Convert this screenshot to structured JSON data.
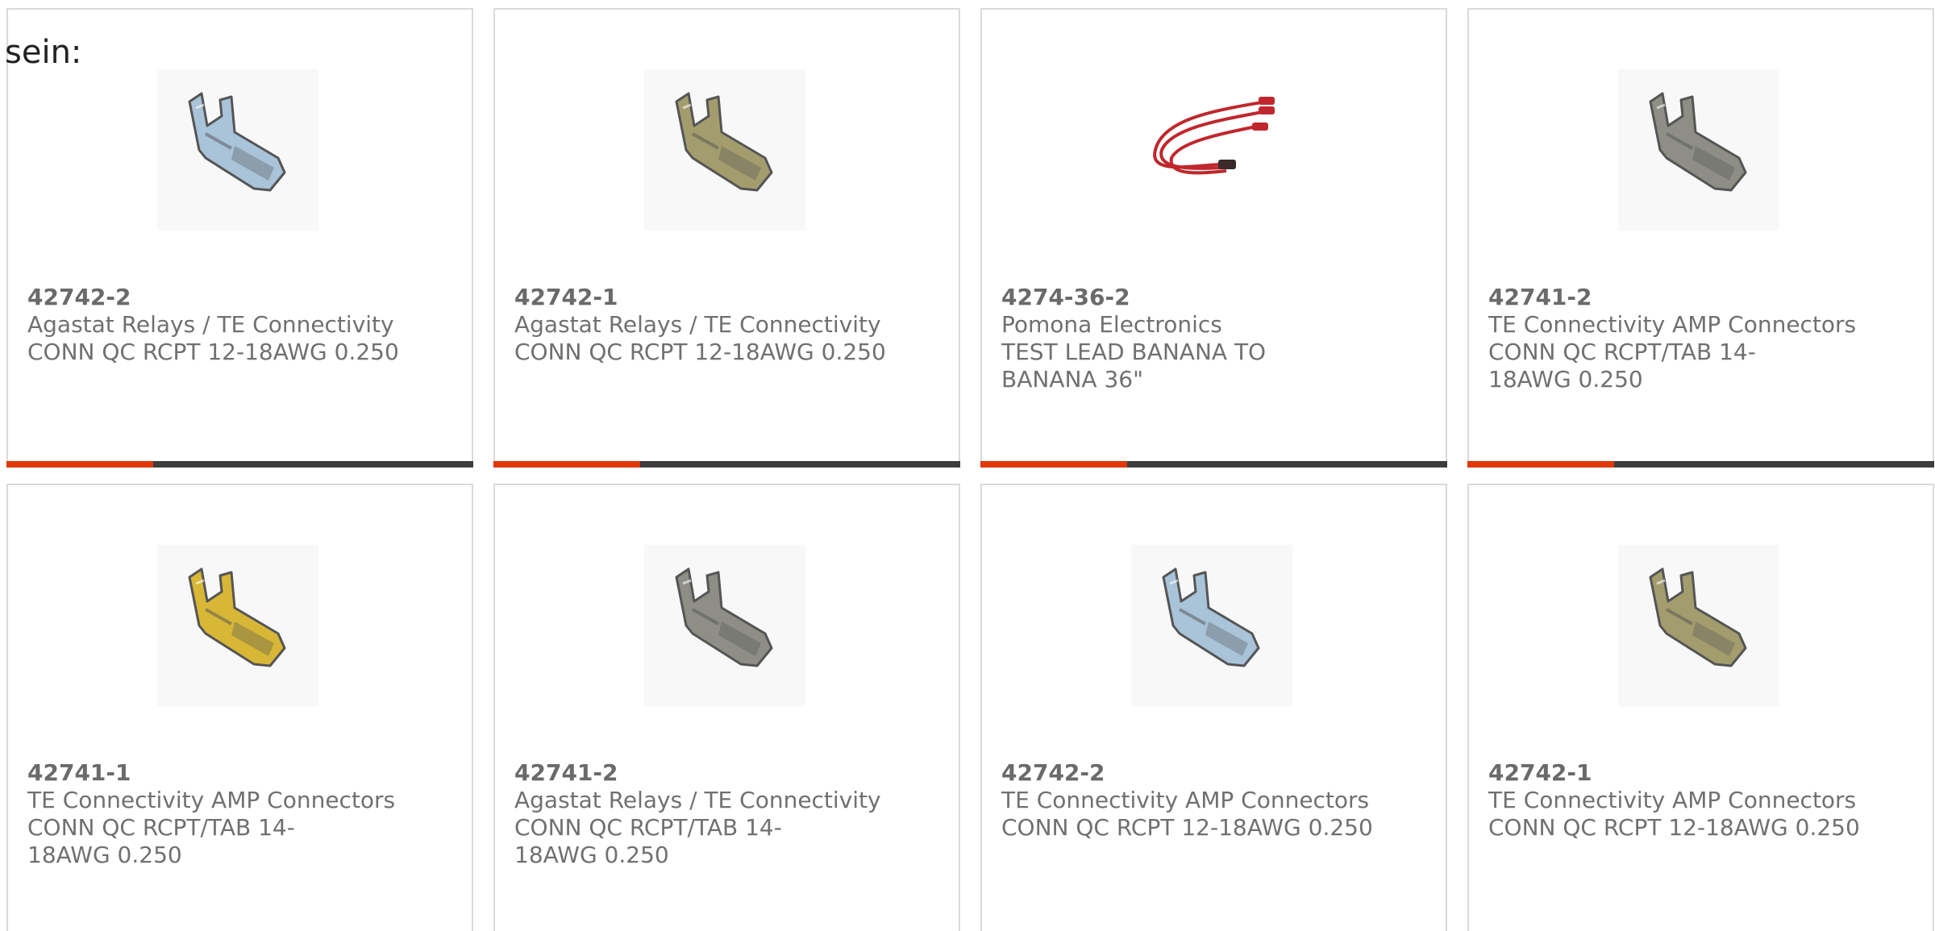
{
  "intro_text": "sein:",
  "colors": {
    "accent": "#e2360b",
    "bar_dark": "#3d3d3d",
    "text": "#707070",
    "border": "#dadada"
  },
  "products": [
    {
      "part_number": "42742-2",
      "manufacturer": "Agastat Relays / TE Connectivity",
      "description": "CONN QC RCPT 12-18AWG 0.250",
      "image": "connector-silver-icon",
      "tint": "#a9c3d9",
      "bar_accent_fraction": 0.315
    },
    {
      "part_number": "42742-1",
      "manufacturer": "Agastat Relays / TE Connectivity",
      "description": "CONN QC RCPT 12-18AWG 0.250",
      "image": "connector-brass-icon",
      "tint": "#a39d6e",
      "bar_accent_fraction": 0.315
    },
    {
      "part_number": "4274-36-2",
      "manufacturer": "Pomona Electronics",
      "description": "TEST LEAD BANANA TO BANANA 36\"",
      "image": "test-lead-icon",
      "tint": "#c0272d",
      "bar_accent_fraction": 0.315
    },
    {
      "part_number": "42741-2",
      "manufacturer": "TE Connectivity AMP Connectors",
      "description": "CONN QC RCPT/TAB 14-18AWG 0.250",
      "image": "connector-steel-icon",
      "tint": "#8e8e86",
      "bar_accent_fraction": 0.315
    },
    {
      "part_number": "42741-1",
      "manufacturer": "TE Connectivity AMP Connectors",
      "description": "CONN QC RCPT/TAB 14-18AWG 0.250",
      "image": "connector-gold-icon",
      "tint": "#d8b737",
      "bar_accent_fraction": 0
    },
    {
      "part_number": "42741-2",
      "manufacturer": "Agastat Relays / TE Connectivity",
      "description": "CONN QC RCPT/TAB 14-18AWG 0.250",
      "image": "connector-steel-icon",
      "tint": "#8e8e86",
      "bar_accent_fraction": 0
    },
    {
      "part_number": "42742-2",
      "manufacturer": "TE Connectivity AMP Connectors",
      "description": "CONN QC RCPT 12-18AWG 0.250",
      "image": "connector-silver-icon",
      "tint": "#a9c3d9",
      "bar_accent_fraction": 0
    },
    {
      "part_number": "42742-1",
      "manufacturer": "TE Connectivity AMP Connectors",
      "description": "CONN QC RCPT 12-18AWG 0.250",
      "image": "connector-brass-icon",
      "tint": "#a39d6e",
      "bar_accent_fraction": 0
    }
  ]
}
